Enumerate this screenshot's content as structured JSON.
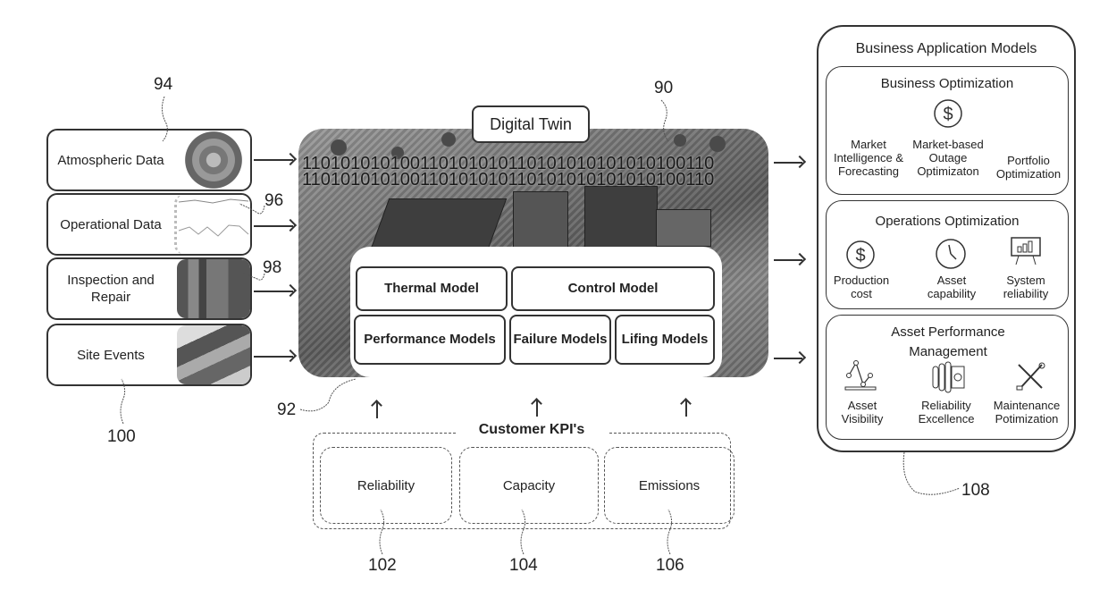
{
  "inputs": [
    {
      "label": "Atmospheric Data",
      "ref": "94",
      "image": "weather-radar-image"
    },
    {
      "label": "Operational Data",
      "ref": "96",
      "image": "operational-trend-chart-image"
    },
    {
      "label": "Inspection and Repair",
      "ref": "98",
      "image": "turbine-blade-image"
    },
    {
      "label": "Site Events",
      "ref": "100",
      "image": "plant-site-photo"
    }
  ],
  "digital_twin": {
    "title": "Digital Twin",
    "ref": "90",
    "models_ref": "92",
    "binary_lines": [
      "110101010100110101010110101010101010100110",
      "110101010100110101010110101010101010100110"
    ],
    "models": [
      {
        "label": "Thermal Model"
      },
      {
        "label": "Control Model"
      },
      {
        "label": "Performance Models"
      },
      {
        "label": "Failure Models"
      },
      {
        "label": "Lifing Models"
      }
    ]
  },
  "customer_kpis": {
    "title": "Customer KPI's",
    "items": [
      {
        "label": "Reliability",
        "ref": "102"
      },
      {
        "label": "Capacity",
        "ref": "104"
      },
      {
        "label": "Emissions",
        "ref": "106"
      }
    ]
  },
  "business_application_models": {
    "title": "Business Application Models",
    "ref": "108",
    "sections": [
      {
        "title": "Business Optimization",
        "icon": "dollar-icon",
        "items": [
          {
            "label": "Market Intelligence & Forecasting"
          },
          {
            "label": "Market-based Outage Optimizaton"
          },
          {
            "label": "Portfolio Optimization"
          }
        ]
      },
      {
        "title": "Operations Optimization",
        "items": [
          {
            "label": "Production cost",
            "icon": "dollar-icon"
          },
          {
            "label": "Asset capability",
            "icon": "clock-icon"
          },
          {
            "label": "System reliability",
            "icon": "bar-chart-board-icon"
          }
        ]
      },
      {
        "title": "Asset Performance Management",
        "items": [
          {
            "label": "Asset Visibility",
            "icon": "line-graph-icon"
          },
          {
            "label": "Reliability Excellence",
            "icon": "turbine-rotor-icon"
          },
          {
            "label": "Maintenance Potimization",
            "icon": "wrench-screwdriver-icon"
          }
        ]
      }
    ]
  }
}
